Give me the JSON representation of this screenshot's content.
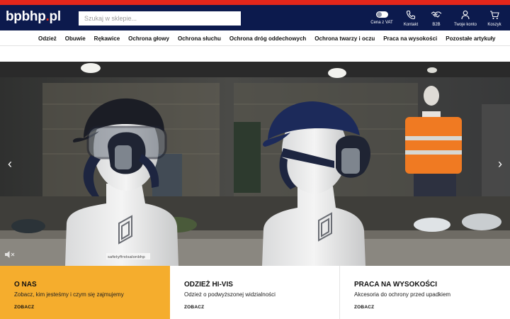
{
  "brand": {
    "logo_main": "bpbhp",
    "logo_dot": ".",
    "logo_tld": "pl"
  },
  "search": {
    "placeholder": "Szukaj w sklepie..."
  },
  "header_actions": [
    {
      "label": "Cena z VAT",
      "icon": "vat-toggle"
    },
    {
      "label": "Kontakt",
      "icon": "phone-icon"
    },
    {
      "label": "B2B",
      "icon": "handshake-icon"
    },
    {
      "label": "Twoje konto",
      "icon": "user-icon"
    },
    {
      "label": "Koszyk",
      "icon": "cart-icon"
    }
  ],
  "nav": {
    "items": [
      "Odzież",
      "Obuwie",
      "Rękawice",
      "Ochrona głowy",
      "Ochrona słuchu",
      "Ochrona dróg oddechowych",
      "Ochrona twarzy i oczu",
      "Praca na wysokości",
      "Pozostałe artykuły"
    ]
  },
  "hero": {
    "prev_icon": "‹",
    "next_icon": "›",
    "mute_icon": "speaker-muted-icon",
    "stand_text": "safetyfirstsalonbhp"
  },
  "cards": [
    {
      "title": "O NAS",
      "text": "Zobacz, kim jesteśmy i czym się zajmujemy",
      "link": "ZOBACZ"
    },
    {
      "title": "ODZIEŻ HI-VIS",
      "text": "Odzież o podwyższonej widzialności",
      "link": "ZOBACZ"
    },
    {
      "title": "PRACA NA WYSOKOŚCI",
      "text": "Akcesoria do ochrony przed upadkiem",
      "link": "ZOBACZ"
    }
  ],
  "colors": {
    "header": "#0c1a4d",
    "accent_red": "#e3261b",
    "card_yellow": "#f5ad2d"
  }
}
